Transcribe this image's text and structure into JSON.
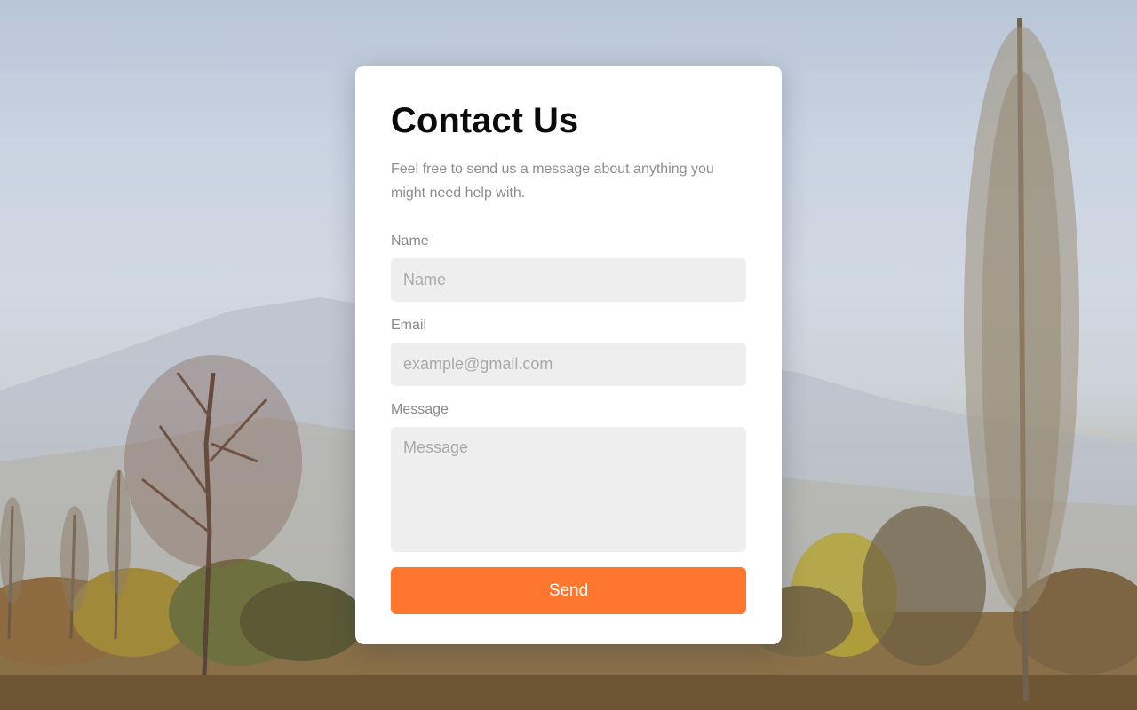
{
  "contact": {
    "title": "Contact Us",
    "subtitle": "Feel free to send us a message about anything you might need help with.",
    "name_label": "Name",
    "name_placeholder": "Name",
    "email_label": "Email",
    "email_placeholder": "example@gmail.com",
    "message_label": "Message",
    "message_placeholder": "Message",
    "send_label": "Send"
  },
  "colors": {
    "accent": "#ff772f",
    "field_bg": "#eeeeee",
    "card_bg": "#ffffff"
  }
}
